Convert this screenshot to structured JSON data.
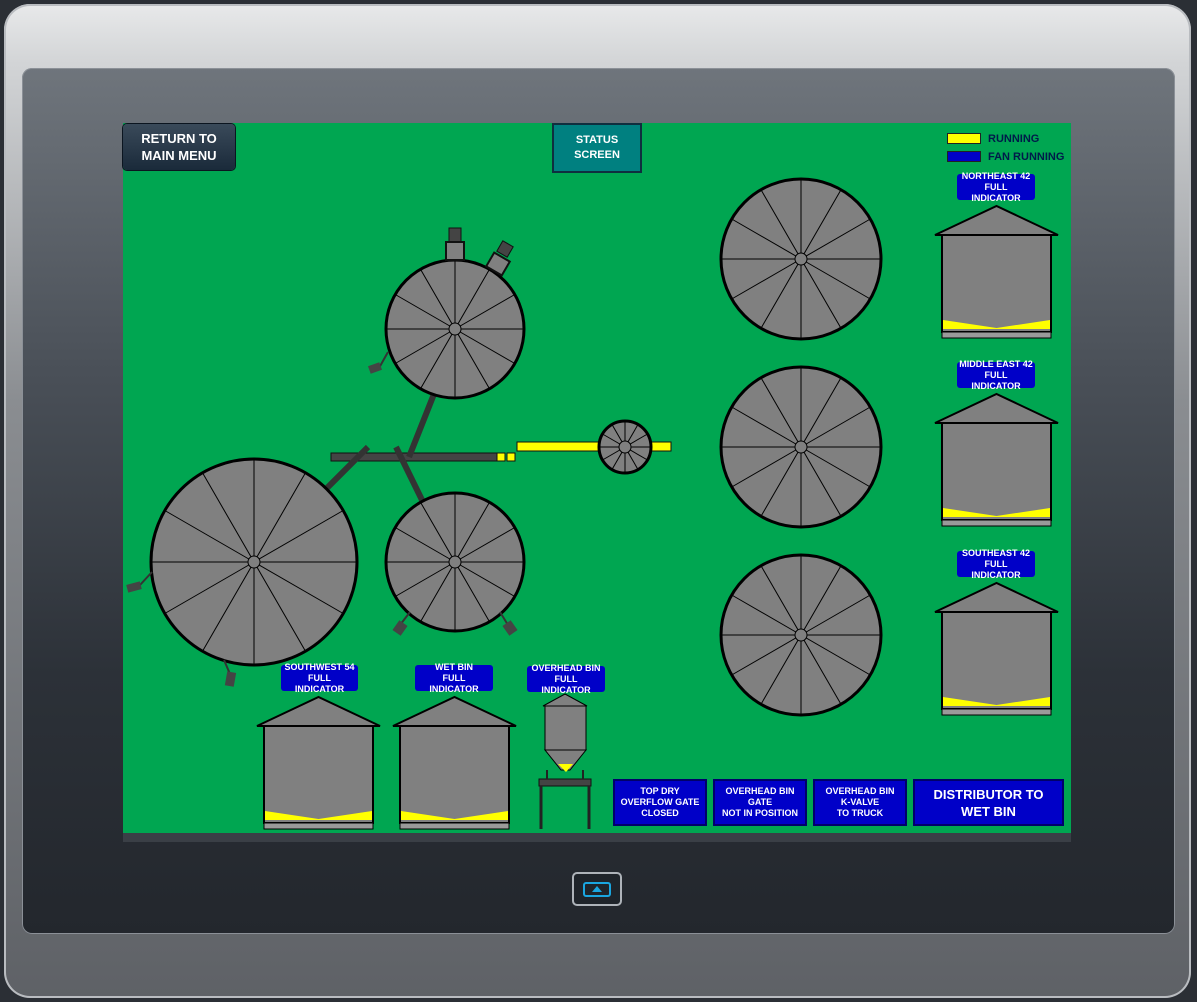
{
  "buttons": {
    "return_main_menu": "RETURN TO\nMAIN MENU",
    "status_screen": "STATUS\nSCREEN",
    "distributor": "DISTRIBUTOR TO\nWET BIN"
  },
  "legend": {
    "running_label": "RUNNING",
    "running_color": "#ffff00",
    "fan_running_label": "FAN RUNNING",
    "fan_running_color": "#0000c8"
  },
  "indicators": {
    "northeast": "NORTHEAST 42\nFULL INDICATOR",
    "middle_east": "MIDDLE EAST 42\nFULL INDICATOR",
    "southeast": "SOUTHEAST 42\nFULL INDICATOR",
    "southwest": "SOUTHWEST 54\nFULL INDICATOR",
    "wet_bin": "WET BIN\nFULL INDICATOR",
    "overhead_bin": "OVERHEAD BIN\nFULL INDICATOR"
  },
  "status_boxes": {
    "top_dry": "TOP DRY\nOVERFLOW GATE\nCLOSED",
    "overhead_gate": "OVERHEAD BIN\nGATE\nNOT IN POSITION",
    "overhead_kvalve": "OVERHEAD BIN\nK-VALVE\nTO TRUCK"
  },
  "colors": {
    "screen_bg": "#00a651",
    "bin_gray": "#808080",
    "indicator_blue": "#0000c8",
    "running_yellow": "#ffff00"
  },
  "icons": {
    "home": "home-icon"
  }
}
